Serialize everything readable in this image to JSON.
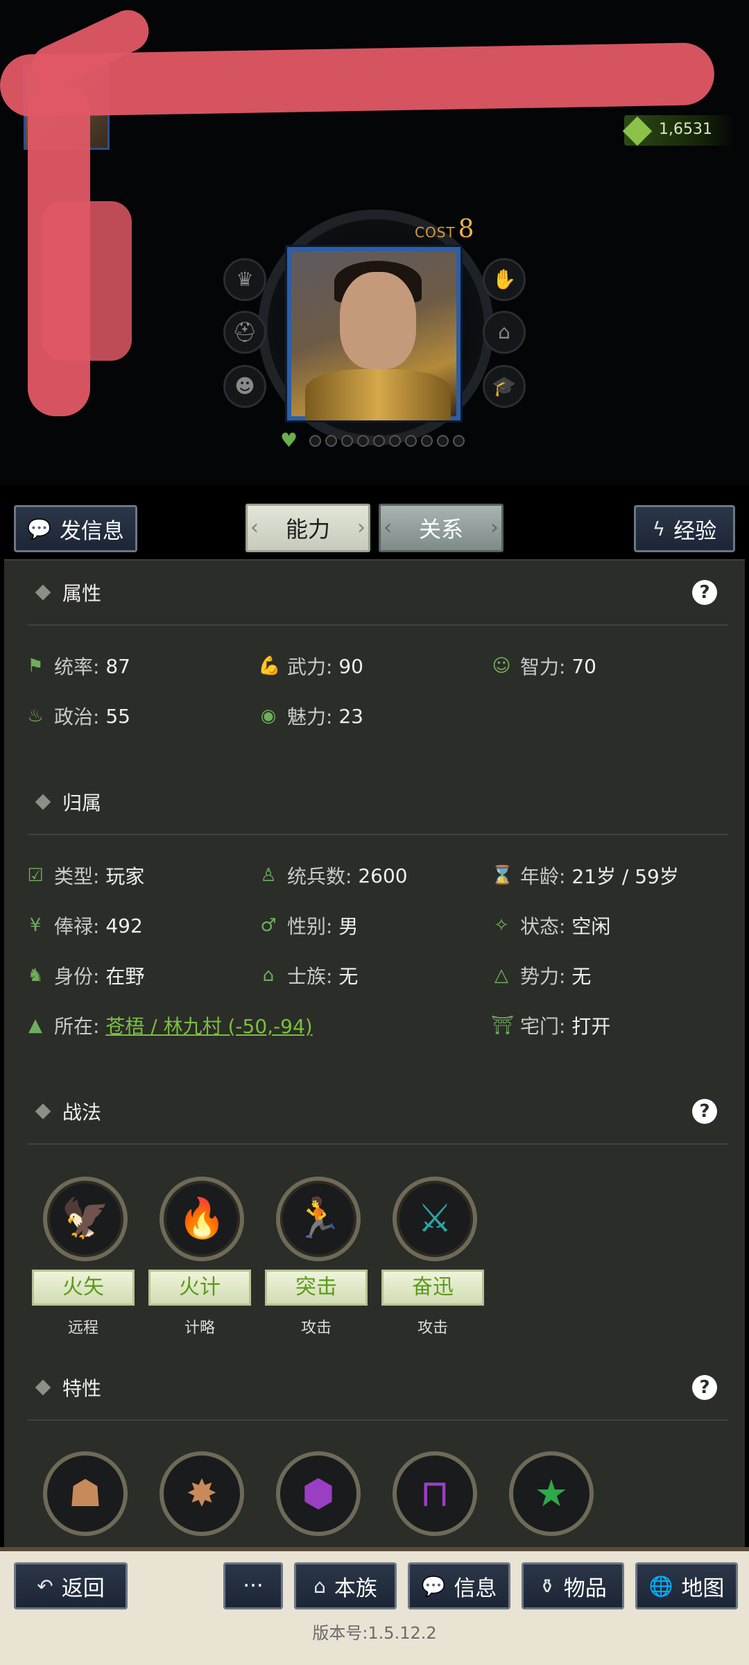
{
  "header": {
    "gold_value": "1,6531",
    "cost_label": "COST",
    "cost_value": "8"
  },
  "tabs": {
    "send_message": "发信息",
    "ability": "能力",
    "relations": "关系",
    "experience": "经验"
  },
  "attributes": {
    "title": "属性",
    "help": "?",
    "items": [
      {
        "label": "统率:",
        "value": "87",
        "icon": "flag-icon"
      },
      {
        "label": "武力:",
        "value": "90",
        "icon": "arm-icon"
      },
      {
        "label": "智力:",
        "value": "70",
        "icon": "brain-icon"
      },
      {
        "label": "政治:",
        "value": "55",
        "icon": "pot-icon"
      },
      {
        "label": "魅力:",
        "value": "23",
        "icon": "eye-icon"
      }
    ]
  },
  "affiliation": {
    "title": "归属",
    "items": [
      {
        "label": "类型:",
        "value": "玩家",
        "icon": "calendar-check-icon"
      },
      {
        "label": "统兵数:",
        "value": "2600",
        "icon": "soldier-icon"
      },
      {
        "label": "年龄:",
        "value": "21岁 / 59岁",
        "icon": "age-icon"
      },
      {
        "label": "俸禄:",
        "value": "492",
        "icon": "yen-icon"
      },
      {
        "label": "性别:",
        "value": "男",
        "icon": "gender-icon"
      },
      {
        "label": "状态:",
        "value": "空闲",
        "icon": "status-icon"
      },
      {
        "label": "身份:",
        "value": "在野",
        "icon": "identity-icon"
      },
      {
        "label": "士族:",
        "value": "无",
        "icon": "clan-icon"
      },
      {
        "label": "势力:",
        "value": "无",
        "icon": "faction-icon"
      },
      {
        "label": "所在:",
        "value": "苍梧 / 林九村 (-50,-94)",
        "icon": "location-icon"
      },
      {
        "label": "宅门:",
        "value": "打开",
        "icon": "gate-icon"
      }
    ]
  },
  "tactics": {
    "title": "战法",
    "help": "?",
    "items": [
      {
        "name": "火矢",
        "type": "远程",
        "icon": "fire-arrow-icon",
        "color": "#c98a5a"
      },
      {
        "name": "火计",
        "type": "计略",
        "icon": "fire-plot-icon",
        "color": "#e0a81c"
      },
      {
        "name": "突击",
        "type": "攻击",
        "icon": "charge-icon",
        "color": "#27b3b0"
      },
      {
        "name": "奋迅",
        "type": "攻击",
        "icon": "crossed-swords-icon",
        "color": "#2aa6a8"
      }
    ]
  },
  "traits": {
    "title": "特性",
    "help": "?",
    "items": [
      {
        "icon": "cloak-icon",
        "color": "#c98a5a"
      },
      {
        "icon": "tree-icon",
        "color": "#c98a5a"
      },
      {
        "icon": "rock-icon",
        "color": "#9a3fc4"
      },
      {
        "icon": "frame-icon",
        "color": "#9a3fc4"
      },
      {
        "icon": "helmet-icon",
        "color": "#2ea84a"
      }
    ]
  },
  "bottom_nav": {
    "back": "返回",
    "more": "···",
    "clan": "本族",
    "info": "信息",
    "items": "物品",
    "map": "地图"
  },
  "version": "版本号:1.5.12.2"
}
